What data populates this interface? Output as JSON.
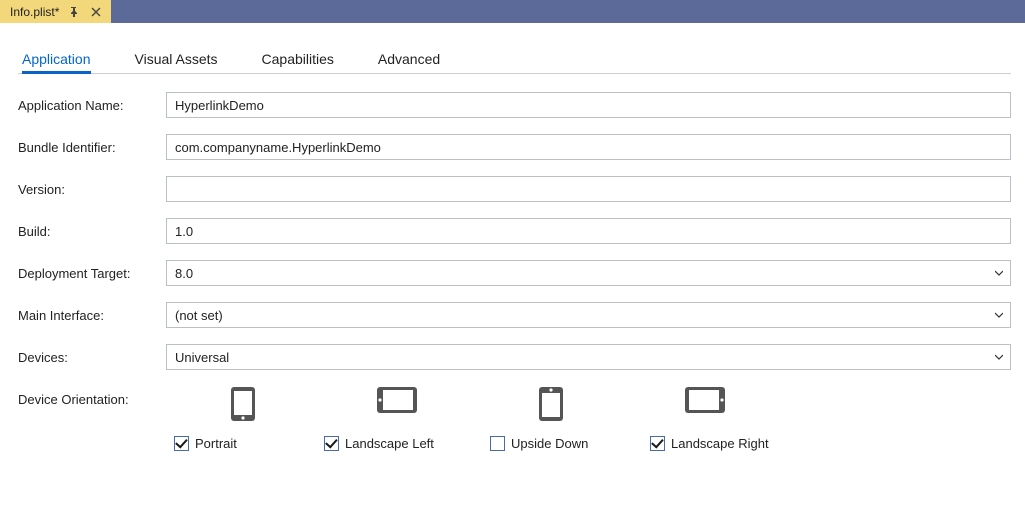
{
  "titlebar": {
    "doc_title": "Info.plist*"
  },
  "tabs": {
    "application": "Application",
    "visual_assets": "Visual Assets",
    "capabilities": "Capabilities",
    "advanced": "Advanced"
  },
  "labels": {
    "app_name": "Application Name:",
    "bundle_id": "Bundle Identifier:",
    "version": "Version:",
    "build": "Build:",
    "deploy_target": "Deployment Target:",
    "main_interface": "Main Interface:",
    "devices": "Devices:",
    "orientation": "Device Orientation:"
  },
  "fields": {
    "app_name": "HyperlinkDemo",
    "bundle_id": "com.companyname.HyperlinkDemo",
    "version": "",
    "build": "1.0",
    "deploy_target": "8.0",
    "main_interface": "(not set)",
    "devices": "Universal"
  },
  "orientation": {
    "portrait": {
      "label": "Portrait",
      "checked": true
    },
    "landscape_left": {
      "label": "Landscape Left",
      "checked": true
    },
    "upside_down": {
      "label": "Upside Down",
      "checked": false
    },
    "landscape_right": {
      "label": "Landscape Right",
      "checked": true
    }
  }
}
